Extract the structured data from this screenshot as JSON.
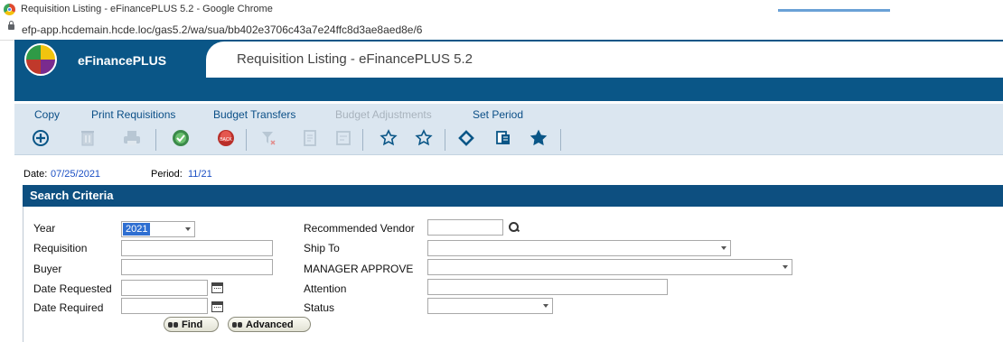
{
  "browser": {
    "window_title": "Requisition Listing - eFinancePLUS 5.2 - Google Chrome",
    "url": "efp-app.hcdemain.hcde.loc/gas5.2/wa/sua/bb402e3706c43a7e24ffc8d3ae8aed8e/6"
  },
  "app": {
    "name": "eFinancePLUS",
    "page_title": "Requisition Listing - eFinancePLUS 5.2",
    "brand_color": "#0a5687"
  },
  "menu": {
    "copy": "Copy",
    "print_requisitions": "Print Requisitions",
    "budget_transfers": "Budget Transfers",
    "budget_adjustments": "Budget Adjustments",
    "set_period": "Set Period"
  },
  "toolbar_icons": [
    "add-icon",
    "delete-icon",
    "print-icon",
    "approve-icon",
    "back-icon",
    "filter-clear-icon",
    "document-icon",
    "form-icon",
    "star-outline-icon",
    "star-outline-icon",
    "diamond-icon",
    "copy-icon",
    "star-filled-icon"
  ],
  "status": {
    "date_label": "Date:",
    "date_value": "07/25/2021",
    "period_label": "Period:",
    "period_value": "11/21"
  },
  "search": {
    "title": "Search Criteria",
    "year_label": "Year",
    "year_value": "2021",
    "requisition_label": "Requisition",
    "requisition_value": "",
    "buyer_label": "Buyer",
    "buyer_value": "",
    "date_requested_label": "Date Requested",
    "date_requested_value": "",
    "date_required_label": "Date Required",
    "date_required_value": "",
    "vendor_label": "Recommended Vendor",
    "vendor_value": "",
    "ship_to_label": "Ship To",
    "ship_to_value": "",
    "manager_label": "MANAGER APPROVE",
    "manager_value": "",
    "attention_label": "Attention",
    "attention_value": "",
    "status_label": "Status",
    "status_value": "",
    "find_label": "Find",
    "advanced_label": "Advanced"
  }
}
